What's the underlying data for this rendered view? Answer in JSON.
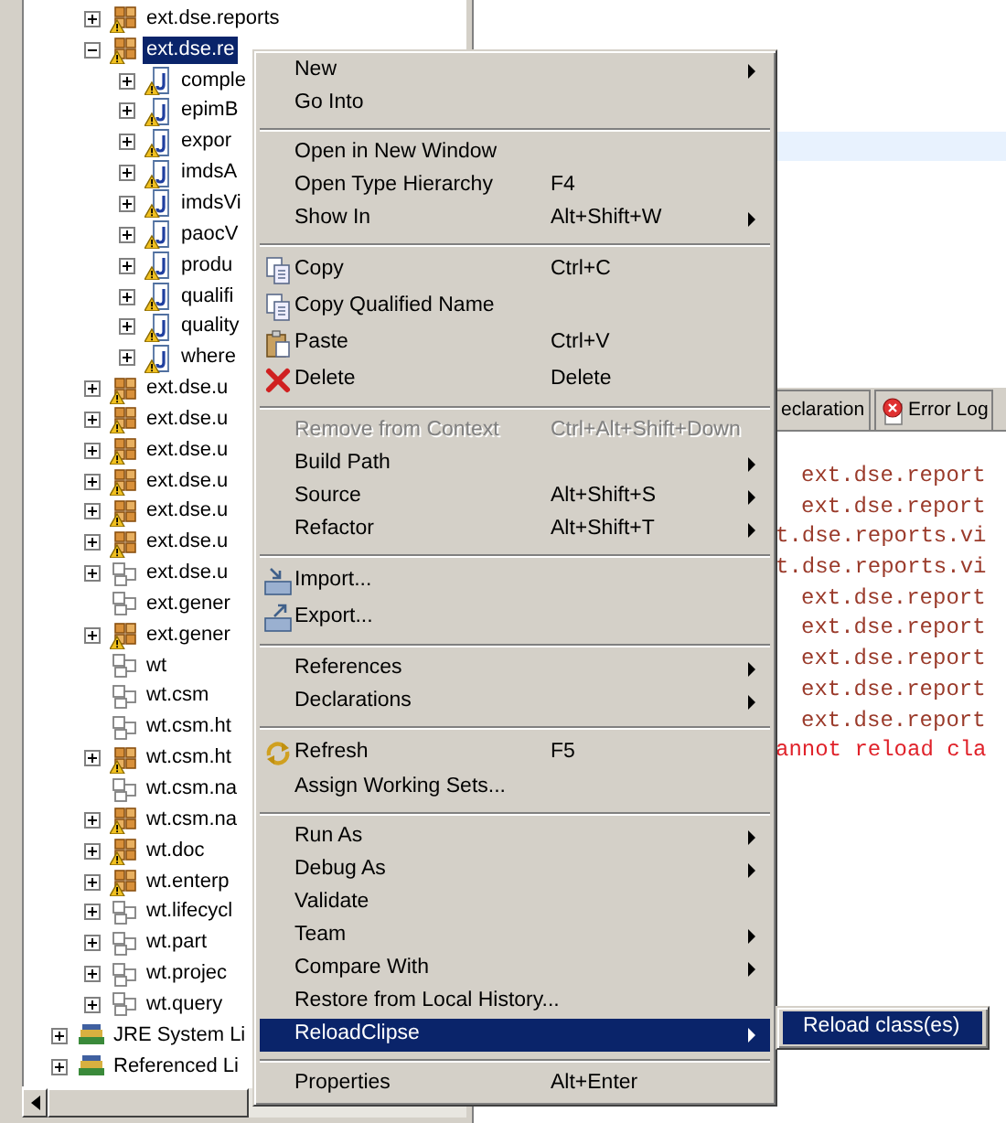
{
  "tree": {
    "source_folder_items": [
      {
        "label": "ext.dse.reports",
        "kind": "package",
        "has_children": true,
        "expanded": false,
        "selected": false
      },
      {
        "label": "ext.dse.re",
        "kind": "package",
        "has_children": true,
        "expanded": true,
        "selected": true,
        "children": [
          {
            "label": "comple",
            "kind": "class",
            "has_children": true,
            "expanded": false,
            "selected": false
          },
          {
            "label": "epimB",
            "kind": "class",
            "has_children": true,
            "expanded": false,
            "selected": false
          },
          {
            "label": "expor",
            "kind": "class",
            "has_children": true,
            "expanded": false,
            "selected": false
          },
          {
            "label": "imdsA",
            "kind": "class",
            "has_children": true,
            "expanded": false,
            "selected": false
          },
          {
            "label": "imdsVi",
            "kind": "class",
            "has_children": true,
            "expanded": false,
            "selected": false
          },
          {
            "label": "paocV",
            "kind": "class",
            "has_children": true,
            "expanded": false,
            "selected": false
          },
          {
            "label": "produ",
            "kind": "class",
            "has_children": true,
            "expanded": false,
            "selected": false
          },
          {
            "label": "qualifi",
            "kind": "class",
            "has_children": true,
            "expanded": false,
            "selected": false
          },
          {
            "label": "quality",
            "kind": "class",
            "has_children": true,
            "expanded": false,
            "selected": false
          },
          {
            "label": "where",
            "kind": "class",
            "has_children": true,
            "expanded": false,
            "selected": false
          }
        ]
      },
      {
        "label": "ext.dse.u",
        "kind": "package",
        "has_children": true,
        "expanded": false,
        "selected": false
      },
      {
        "label": "ext.dse.u",
        "kind": "package",
        "has_children": true,
        "expanded": false,
        "selected": false
      },
      {
        "label": "ext.dse.u",
        "kind": "package",
        "has_children": true,
        "expanded": false,
        "selected": false
      },
      {
        "label": "ext.dse.u",
        "kind": "package",
        "has_children": true,
        "expanded": false,
        "selected": false
      },
      {
        "label": "ext.dse.u",
        "kind": "package",
        "has_children": true,
        "expanded": false,
        "selected": false
      },
      {
        "label": "ext.dse.u",
        "kind": "package",
        "has_children": true,
        "expanded": false,
        "selected": false
      },
      {
        "label": "ext.dse.u",
        "kind": "empty-package",
        "has_children": true,
        "expanded": false,
        "selected": false
      },
      {
        "label": "ext.gener",
        "kind": "empty-package",
        "has_children": false,
        "selected": false
      },
      {
        "label": "ext.gener",
        "kind": "package",
        "has_children": true,
        "expanded": false,
        "selected": false
      },
      {
        "label": "wt",
        "kind": "empty-package",
        "has_children": false,
        "selected": false
      },
      {
        "label": "wt.csm",
        "kind": "empty-package",
        "has_children": false,
        "selected": false
      },
      {
        "label": "wt.csm.ht",
        "kind": "empty-package",
        "has_children": false,
        "selected": false
      },
      {
        "label": "wt.csm.ht",
        "kind": "package",
        "has_children": true,
        "expanded": false,
        "selected": false
      },
      {
        "label": "wt.csm.na",
        "kind": "empty-package",
        "has_children": false,
        "selected": false
      },
      {
        "label": "wt.csm.na",
        "kind": "package",
        "has_children": true,
        "expanded": false,
        "selected": false
      },
      {
        "label": "wt.doc",
        "kind": "package",
        "has_children": true,
        "expanded": false,
        "selected": false
      },
      {
        "label": "wt.enterp",
        "kind": "package",
        "has_children": true,
        "expanded": false,
        "selected": false
      },
      {
        "label": "wt.lifecycl",
        "kind": "empty-package",
        "has_children": true,
        "expanded": false,
        "selected": false
      },
      {
        "label": "wt.part",
        "kind": "empty-package",
        "has_children": true,
        "expanded": false,
        "selected": false
      },
      {
        "label": "wt.projec",
        "kind": "empty-package",
        "has_children": true,
        "expanded": false,
        "selected": false
      },
      {
        "label": "wt.query",
        "kind": "empty-package",
        "has_children": true,
        "expanded": false,
        "selected": false
      }
    ],
    "project_items": [
      {
        "label": "JRE System Li",
        "kind": "library",
        "has_children": true,
        "expanded": false,
        "selected": false
      },
      {
        "label": "Referenced Li",
        "kind": "library",
        "has_children": true,
        "expanded": false,
        "selected": false
      }
    ]
  },
  "console": {
    "tabs": [
      {
        "label": "eclaration",
        "selected": false
      },
      {
        "label": "Error Log",
        "selected": false
      }
    ],
    "lines": [
      {
        "kind": "entry",
        "text": "ext.dse.report"
      },
      {
        "kind": "entry",
        "text": "ext.dse.report"
      },
      {
        "kind": "detail",
        "text": "t.dse.reports.vi"
      },
      {
        "kind": "detail",
        "text": "t.dse.reports.vi"
      },
      {
        "kind": "entry",
        "text": "ext.dse.report"
      },
      {
        "kind": "entry",
        "text": "ext.dse.report"
      },
      {
        "kind": "entry",
        "text": "ext.dse.report"
      },
      {
        "kind": "entry",
        "text": "ext.dse.report"
      },
      {
        "kind": "entry",
        "text": "ext.dse.report"
      },
      {
        "kind": "error",
        "text": "annot reload cla"
      }
    ]
  },
  "context_menu": {
    "items": [
      {
        "kind": "plain",
        "label": "New",
        "submenu": true,
        "disabled": false,
        "selected": false
      },
      {
        "kind": "plain",
        "label": "Go Into",
        "submenu": false,
        "disabled": false,
        "selected": false
      },
      {
        "kind": "separator"
      },
      {
        "kind": "plain",
        "label": "Open in New Window",
        "submenu": false,
        "disabled": false,
        "selected": false
      },
      {
        "kind": "plain",
        "label": "Open Type Hierarchy",
        "shortcut": "F4",
        "submenu": false,
        "disabled": false,
        "selected": false
      },
      {
        "kind": "plain",
        "label": "Show In",
        "shortcut": "Alt+Shift+W",
        "submenu": true,
        "disabled": false,
        "selected": false
      },
      {
        "kind": "separator"
      },
      {
        "kind": "copy",
        "label": "Copy",
        "shortcut": "Ctrl+C",
        "submenu": false,
        "disabled": false,
        "selected": false
      },
      {
        "kind": "copy",
        "label": "Copy Qualified Name",
        "submenu": false,
        "disabled": false,
        "selected": false
      },
      {
        "kind": "paste",
        "label": "Paste",
        "shortcut": "Ctrl+V",
        "submenu": false,
        "disabled": false,
        "selected": false
      },
      {
        "kind": "delete",
        "label": "Delete",
        "shortcut": "Delete",
        "submenu": false,
        "disabled": false,
        "selected": false
      },
      {
        "kind": "separator"
      },
      {
        "kind": "plain",
        "label": "Remove from Context",
        "shortcut": "Ctrl+Alt+Shift+Down",
        "submenu": false,
        "disabled": true,
        "selected": false
      },
      {
        "kind": "plain",
        "label": "Build Path",
        "submenu": true,
        "disabled": false,
        "selected": false
      },
      {
        "kind": "plain",
        "label": "Source",
        "shortcut": "Alt+Shift+S",
        "submenu": true,
        "disabled": false,
        "selected": false
      },
      {
        "kind": "plain",
        "label": "Refactor",
        "shortcut": "Alt+Shift+T",
        "submenu": true,
        "disabled": false,
        "selected": false
      },
      {
        "kind": "separator"
      },
      {
        "kind": "import",
        "label": "Import...",
        "submenu": false,
        "disabled": false,
        "selected": false
      },
      {
        "kind": "export",
        "label": "Export...",
        "submenu": false,
        "disabled": false,
        "selected": false
      },
      {
        "kind": "separator"
      },
      {
        "kind": "plain",
        "label": "References",
        "submenu": true,
        "disabled": false,
        "selected": false
      },
      {
        "kind": "plain",
        "label": "Declarations",
        "submenu": true,
        "disabled": false,
        "selected": false
      },
      {
        "kind": "separator"
      },
      {
        "kind": "refresh",
        "label": "Refresh",
        "shortcut": "F5",
        "submenu": false,
        "disabled": false,
        "selected": false
      },
      {
        "kind": "plain",
        "label": "Assign Working Sets...",
        "submenu": false,
        "disabled": false,
        "selected": false
      },
      {
        "kind": "separator"
      },
      {
        "kind": "plain",
        "label": "Run As",
        "submenu": true,
        "disabled": false,
        "selected": false
      },
      {
        "kind": "plain",
        "label": "Debug As",
        "submenu": true,
        "disabled": false,
        "selected": false
      },
      {
        "kind": "plain",
        "label": "Validate",
        "submenu": false,
        "disabled": false,
        "selected": false
      },
      {
        "kind": "plain",
        "label": "Team",
        "submenu": true,
        "disabled": false,
        "selected": false
      },
      {
        "kind": "plain",
        "label": "Compare With",
        "submenu": true,
        "disabled": false,
        "selected": false
      },
      {
        "kind": "plain",
        "label": "Restore from Local History...",
        "submenu": false,
        "disabled": false,
        "selected": false
      },
      {
        "kind": "plain",
        "label": "ReloadClipse",
        "submenu": true,
        "disabled": false,
        "selected": true
      },
      {
        "kind": "separator"
      },
      {
        "kind": "plain",
        "label": "Properties",
        "shortcut": "Alt+Enter",
        "submenu": false,
        "disabled": false,
        "selected": false
      }
    ]
  },
  "submenu": {
    "items": [
      {
        "label": "Reload class(es)",
        "selected": true
      }
    ]
  }
}
